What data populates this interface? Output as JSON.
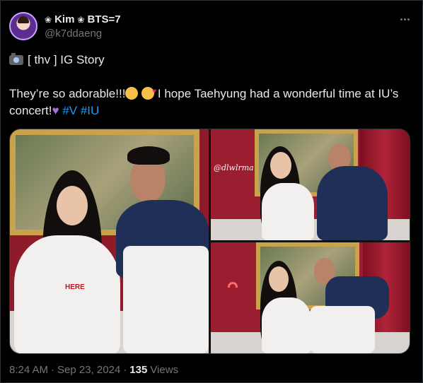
{
  "author": {
    "display_name_part1": "Kim",
    "display_name_part2": "BTS=7",
    "handle": "@k7ddaeng"
  },
  "tweet": {
    "line1_text": "[ thv ] IG Story",
    "line2_part1": "They’re so adorable!!!",
    "line2_part2": "I hope Taehyung had a wonderful time at IU’s",
    "line2_part3": "concert!",
    "hashtags": [
      "#V",
      "#IU"
    ]
  },
  "media": {
    "watermark": "@dlwlrma",
    "shirt_text": "HERE"
  },
  "meta": {
    "time": "8:24 AM",
    "date": "Sep 23, 2024",
    "separator": "·",
    "views_count": "135",
    "views_label": "Views"
  },
  "icons": {
    "flower": "flower-icon",
    "more": "more-icon",
    "camera": "camera-with-flash-icon",
    "crying": "face-holding-back-tears-icon",
    "hearts": "smiling-face-with-hearts-icon",
    "purple_heart": "purple-heart-icon",
    "rainbow": "rainbow-icon"
  },
  "colors": {
    "background": "#000000",
    "text": "#e7e9ea",
    "secondary": "#71767b",
    "link": "#1d9bf0",
    "border": "#2f3336"
  }
}
